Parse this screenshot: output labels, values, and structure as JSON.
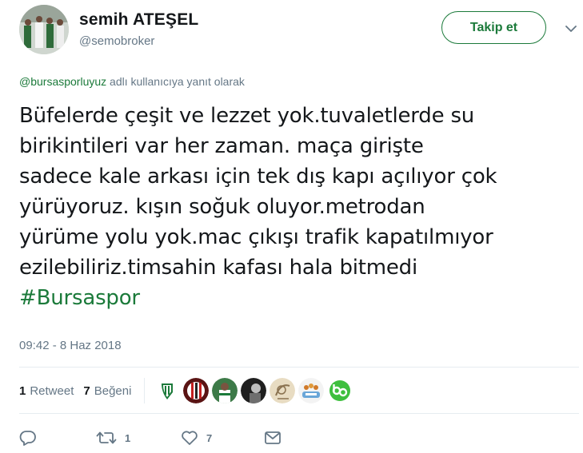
{
  "author": {
    "display_name": "semih ATEŞEL",
    "username": "@semobroker",
    "avatar_icon": "user-avatar"
  },
  "follow_button": {
    "label": "Takip et"
  },
  "menu_icon": "chevron-down-icon",
  "reply_context": {
    "mention": "@bursasporluyuz",
    "suffix": " adlı kullanıcıya yanıt olarak"
  },
  "tweet": {
    "lines": [
      "Büfelerde çeşit ve lezzet yok.tuvaletlerde su",
      "birikintileri var her zaman. maça girişte",
      "sadece kale arkası için tek dış kapı açılıyor çok",
      "yürüyoruz. kışın soğuk oluyor.metrodan",
      "yürüme yolu yok.mac çıkışı trafik kapatılmıyor",
      "ezilebiliriz.timsahin kafası hala bitmedi"
    ],
    "hashtag": "#Bursaspor",
    "timestamp": "09:42 - 8 Haz 2018"
  },
  "stats": {
    "retweet_count": "1",
    "retweet_label": "Retweet",
    "like_count": "7",
    "like_label": "Beğeni"
  },
  "likers": [
    {
      "icon": "bursaspor-crest-avatar",
      "color": "#1b7a3a"
    },
    {
      "icon": "red-striped-avatar",
      "color": "#7a1a1a"
    },
    {
      "icon": "green-player-avatar",
      "color": "#2f6b3a"
    },
    {
      "icon": "black-white-avatar",
      "color": "#2a2a2a"
    },
    {
      "icon": "sketch-avatar",
      "color": "#c8b48a"
    },
    {
      "icon": "crowd-avatar",
      "color": "#6aa6d8"
    },
    {
      "icon": "green-logo-avatar",
      "color": "#3fbf3f"
    }
  ],
  "actions": {
    "reply_icon": "reply-icon",
    "retweet_icon": "retweet-icon",
    "retweet_count": "1",
    "like_icon": "heart-icon",
    "like_count": "7",
    "dm_icon": "envelope-icon"
  },
  "colors": {
    "accent": "#1b7a3a",
    "muted": "#657786",
    "text": "#14171a",
    "divider": "#e6ecf0"
  }
}
